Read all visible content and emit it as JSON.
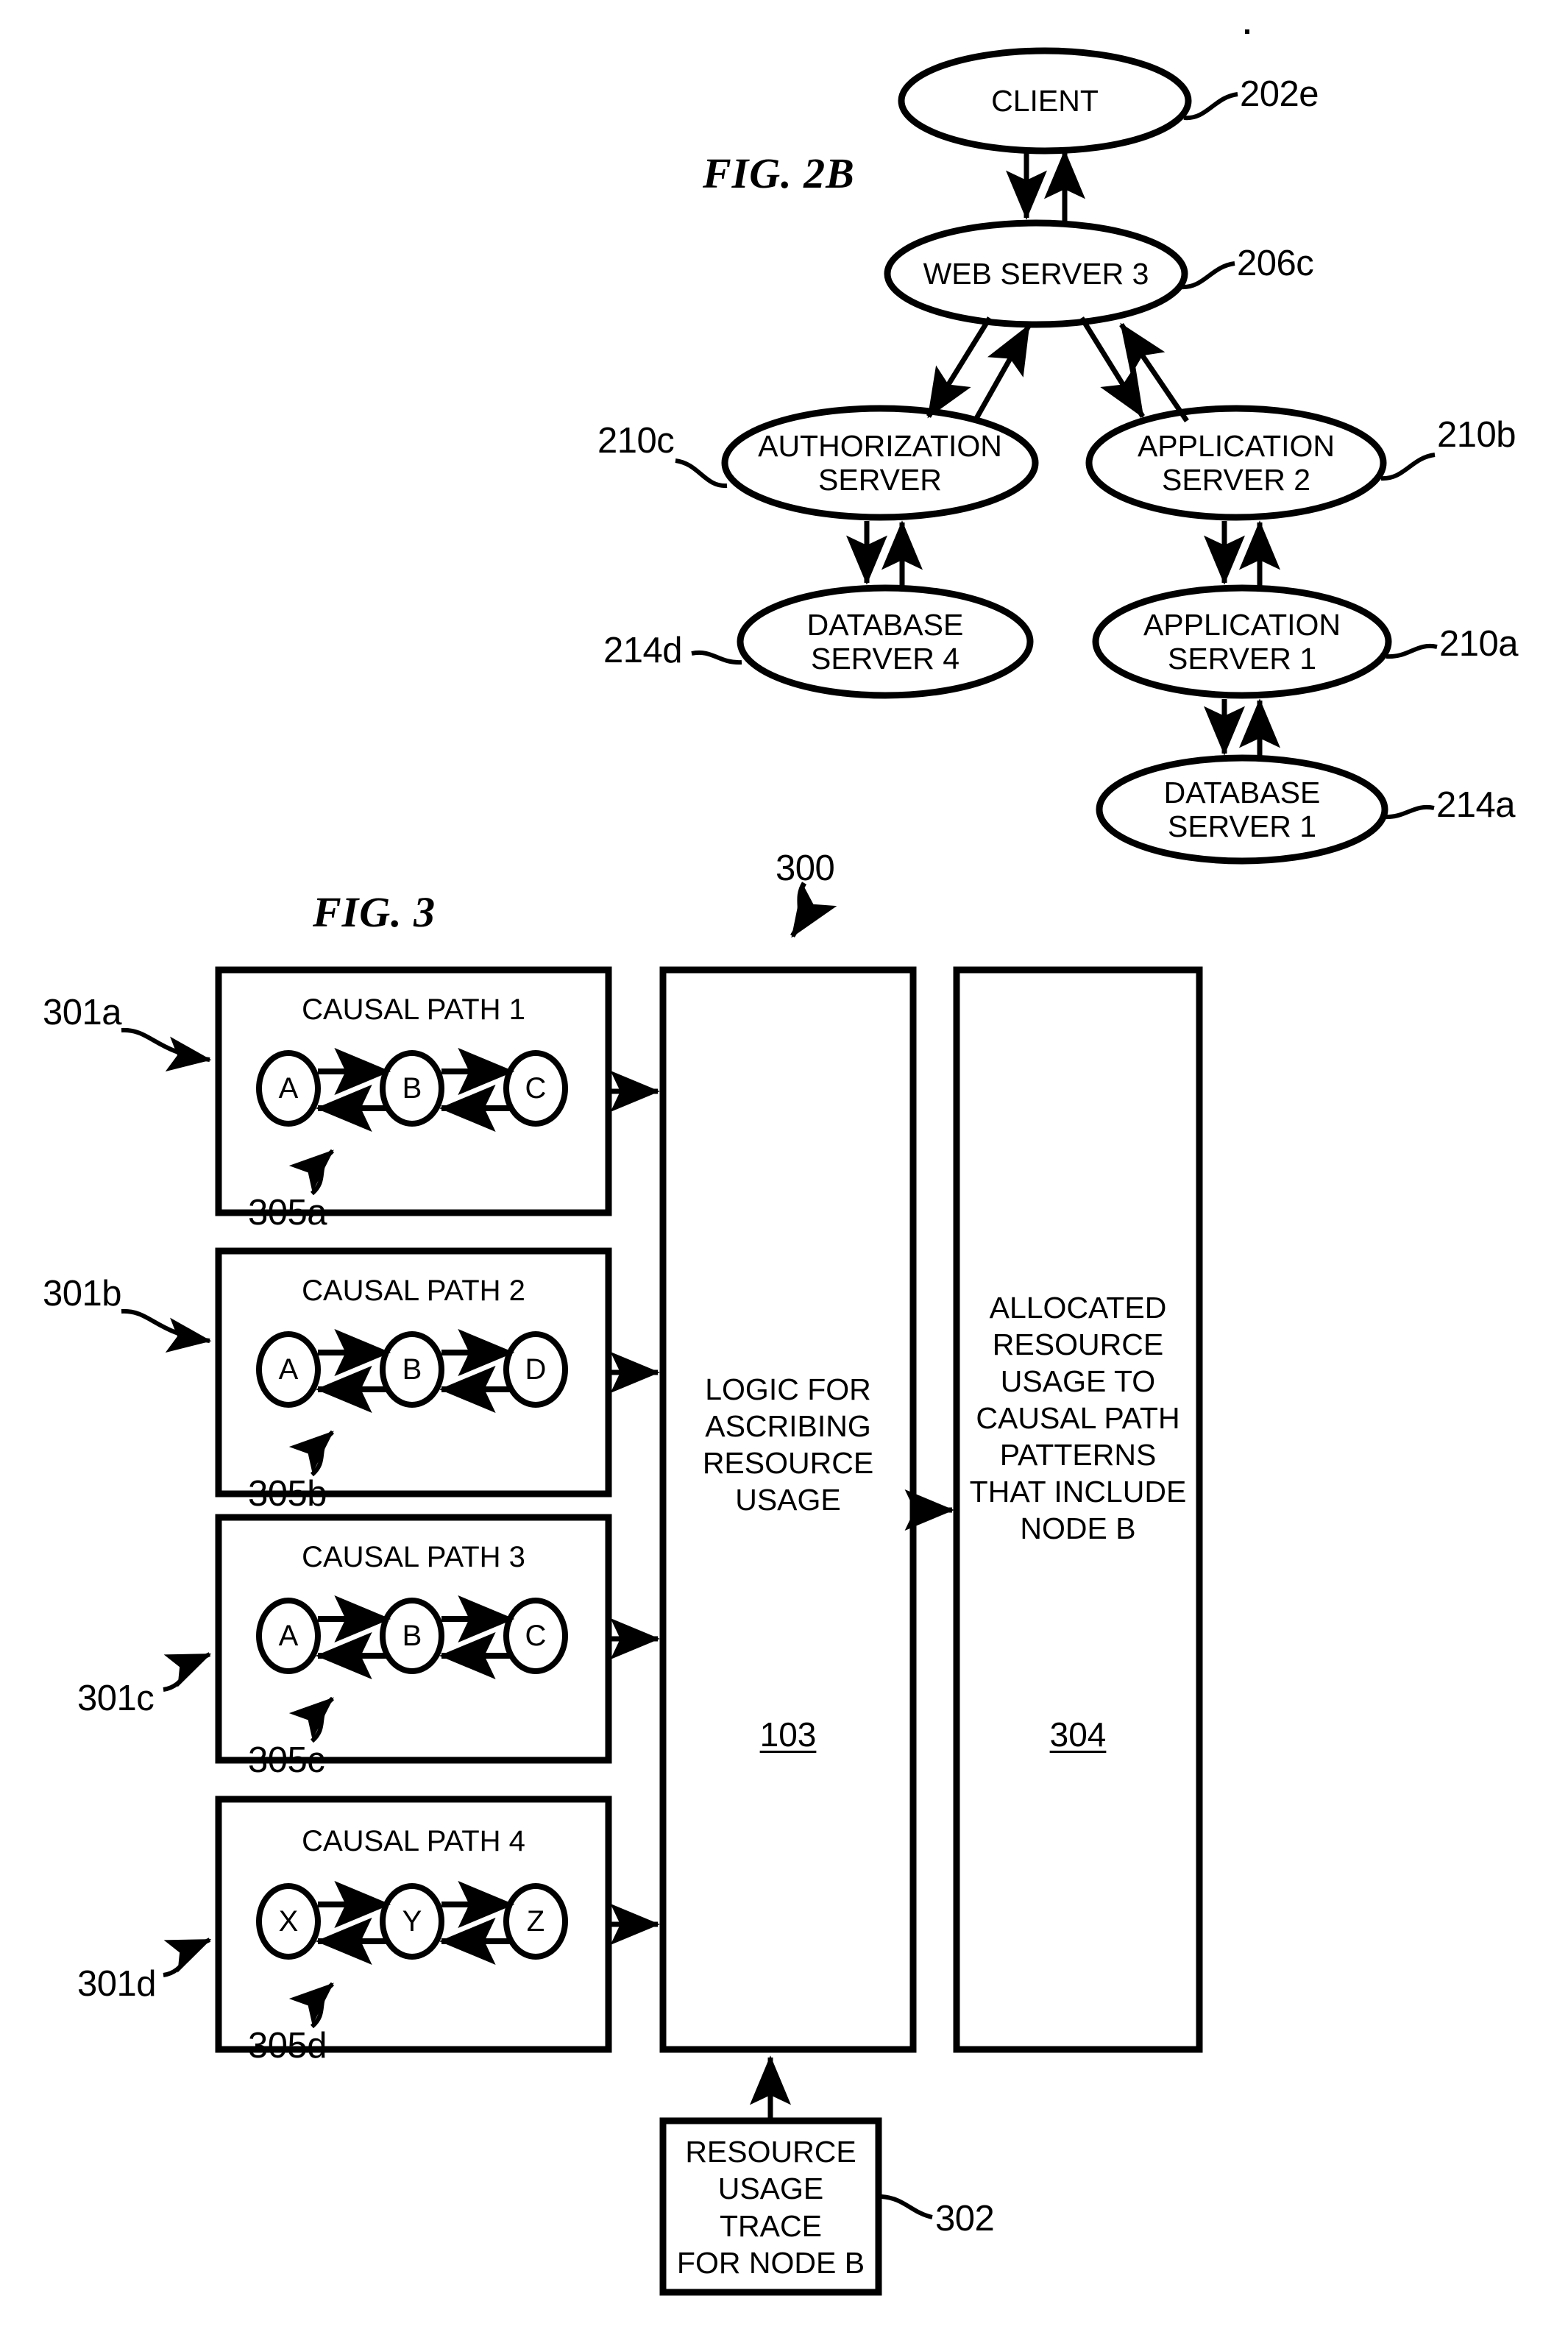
{
  "figures": [
    {
      "id": "fig2b",
      "title": "FIG. 2B",
      "nodes": [
        {
          "id": "client",
          "label": "CLIENT",
          "ref": "202e"
        },
        {
          "id": "web3",
          "label": "WEB SERVER 3",
          "ref": "206c"
        },
        {
          "id": "authsrv",
          "label": "AUTHORIZATION\nSERVER",
          "ref": "210c"
        },
        {
          "id": "app2",
          "label": "APPLICATION\nSERVER 2",
          "ref": "210b"
        },
        {
          "id": "db4",
          "label": "DATABASE\nSERVER 4",
          "ref": "214d"
        },
        {
          "id": "app1",
          "label": "APPLICATION\nSERVER 1",
          "ref": "210a"
        },
        {
          "id": "db1",
          "label": "DATABASE\nSERVER 1",
          "ref": "214a"
        }
      ]
    },
    {
      "id": "fig3",
      "title": "FIG. 3",
      "diagram_ref": "300",
      "causal_paths": [
        {
          "ref": "301a",
          "title": "CAUSAL PATH 1",
          "nodes": [
            "A",
            "B",
            "C"
          ],
          "arrow_ref": "305a"
        },
        {
          "ref": "301b",
          "title": "CAUSAL PATH 2",
          "nodes": [
            "A",
            "B",
            "D"
          ],
          "arrow_ref": "305b"
        },
        {
          "ref": "301c",
          "title": "CAUSAL PATH 3",
          "nodes": [
            "A",
            "B",
            "C"
          ],
          "arrow_ref": "305c"
        },
        {
          "ref": "301d",
          "title": "CAUSAL PATH 4",
          "nodes": [
            "X",
            "Y",
            "Z"
          ],
          "arrow_ref": "305d"
        }
      ],
      "logic_box": {
        "text": "LOGIC FOR\nASCRIBING\nRESOURCE\nUSAGE",
        "ref": "103"
      },
      "output_box": {
        "text": "ALLOCATED\nRESOURCE\nUSAGE TO\nCAUSAL PATH\nPATTERNS\nTHAT INCLUDE\nNODE B",
        "ref": "304"
      },
      "trace_box": {
        "text": "RESOURCE\nUSAGE TRACE\nFOR NODE B",
        "ref": "302"
      }
    }
  ],
  "colors": {
    "ink": "#000000",
    "paper": "#ffffff"
  }
}
